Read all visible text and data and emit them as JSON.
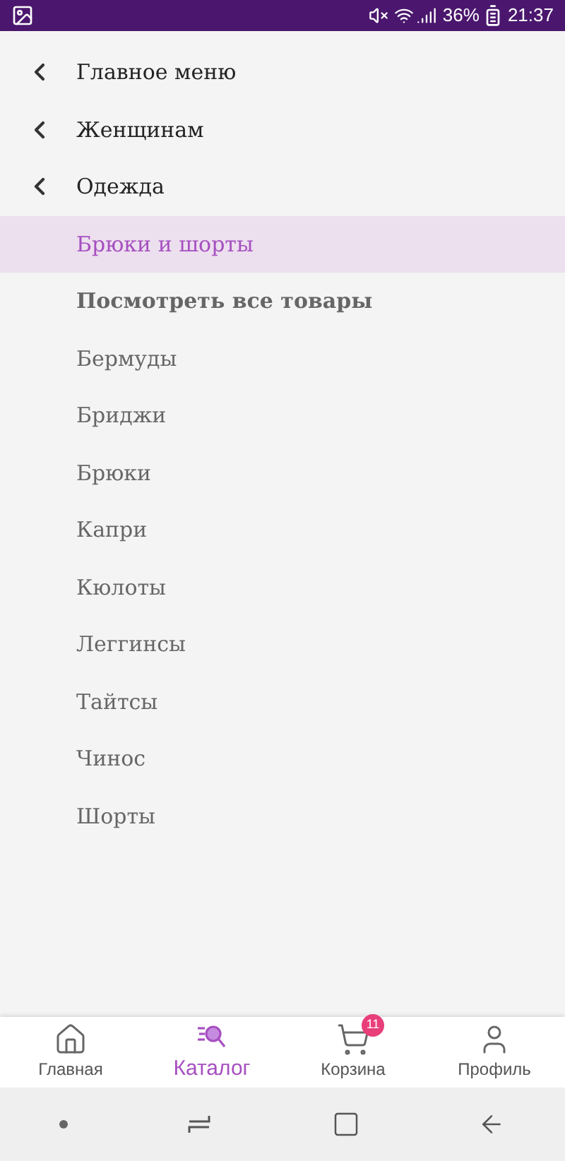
{
  "status_bar": {
    "battery": "36%",
    "time": "21:37"
  },
  "menu": [
    {
      "kind": "back",
      "label": "Главное меню",
      "selected": false
    },
    {
      "kind": "back",
      "label": "Женщинам",
      "selected": false
    },
    {
      "kind": "back",
      "label": "Одежда",
      "selected": false
    },
    {
      "kind": "link",
      "label": "Брюки и шорты",
      "selected": true
    },
    {
      "kind": "all",
      "label": "Посмотреть все товары",
      "selected": false
    },
    {
      "kind": "link",
      "label": "Бермуды",
      "selected": false
    },
    {
      "kind": "link",
      "label": "Бриджи",
      "selected": false
    },
    {
      "kind": "link",
      "label": "Брюки",
      "selected": false
    },
    {
      "kind": "link",
      "label": "Капри",
      "selected": false
    },
    {
      "kind": "link",
      "label": "Кюлоты",
      "selected": false
    },
    {
      "kind": "link",
      "label": "Леггинсы",
      "selected": false
    },
    {
      "kind": "link",
      "label": "Тайтсы",
      "selected": false
    },
    {
      "kind": "link",
      "label": "Чинос",
      "selected": false
    },
    {
      "kind": "link",
      "label": "Шорты",
      "selected": false
    }
  ],
  "tabs": [
    {
      "kind": "home",
      "label": "Главная",
      "selected": false
    },
    {
      "kind": "catalog",
      "label": "Каталог",
      "selected": true
    },
    {
      "kind": "cart",
      "label": "Корзина",
      "selected": false,
      "badge": "11"
    },
    {
      "kind": "profile",
      "label": "Профиль",
      "selected": false
    }
  ]
}
